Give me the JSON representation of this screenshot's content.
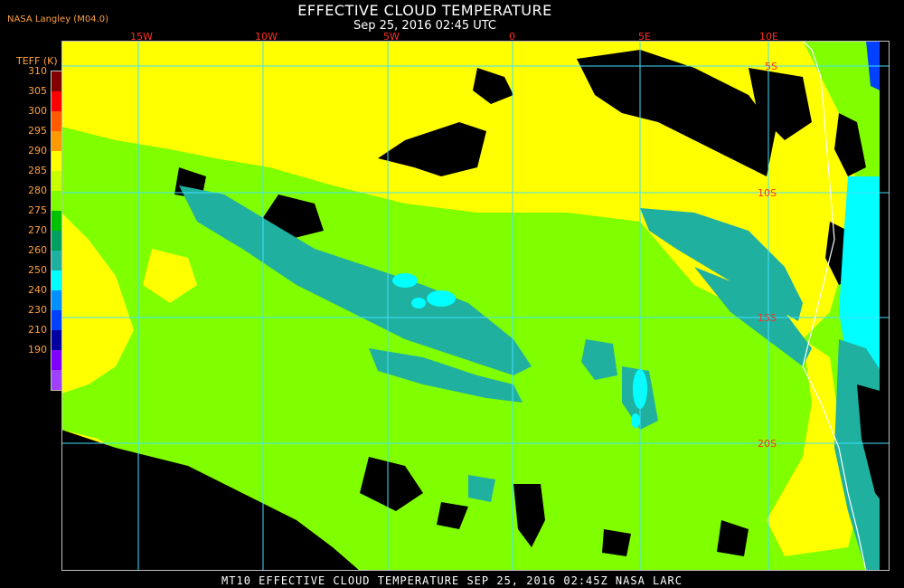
{
  "header": {
    "title": "EFFECTIVE CLOUD TEMPERATURE",
    "subtitle": "Sep 25, 2016 02:45 UTC",
    "credit": "NASA Langley (M04.0)"
  },
  "footer": {
    "text": "MT10  EFFECTIVE CLOUD TEMPERATURE  SEP 25, 2016 02:45Z  NASA LARC"
  },
  "legend": {
    "title": "TEFF (K)",
    "labels": [
      "310",
      "305",
      "300",
      "295",
      "290",
      "285",
      "280",
      "275",
      "270",
      "260",
      "250",
      "240",
      "230",
      "210",
      "190"
    ],
    "colors": [
      "#800000",
      "#ff0000",
      "#ff5a00",
      "#ff9900",
      "#ffff00",
      "#c8ff00",
      "#7fff00",
      "#00c000",
      "#00a060",
      "#20b0a0",
      "#00ffff",
      "#0090ff",
      "#0040ff",
      "#0000a0",
      "#8000ff",
      "#a040ff"
    ]
  },
  "map": {
    "lon_labels": [
      "15W",
      "10W",
      "5W",
      "0",
      "5E",
      "10E"
    ],
    "lat_labels": [
      "5S",
      "10S",
      "15S",
      "20S"
    ],
    "colors": {
      "background_cloud": "#80ff00",
      "warm_cloud": "#ffff00",
      "clear_sky": "#000000",
      "cool_cloud": "#20b0a0",
      "cold_cloud": "#00ffff",
      "grid": "#40e0ff",
      "coast": "#ffffff"
    }
  }
}
